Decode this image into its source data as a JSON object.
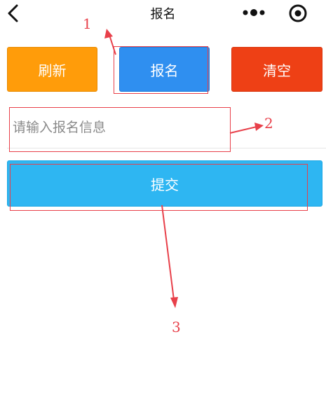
{
  "nav": {
    "title": "报名",
    "back_icon": "chevron-left-icon",
    "more_icon": "more-dots-icon",
    "target_icon": "target-icon"
  },
  "actions": {
    "refresh_label": "刷新",
    "signup_label": "报名",
    "clear_label": "清空"
  },
  "form": {
    "input_value": "",
    "input_placeholder": "请输入报名信息",
    "submit_label": "提交"
  },
  "annotations": {
    "label_1": "1",
    "label_2": "2",
    "label_3": "3"
  },
  "colors": {
    "refresh": "#ff9c0a",
    "signup": "#2f8ff0",
    "clear": "#ee4015",
    "submit": "#2eb6f2",
    "annotation": "#e8404a"
  }
}
